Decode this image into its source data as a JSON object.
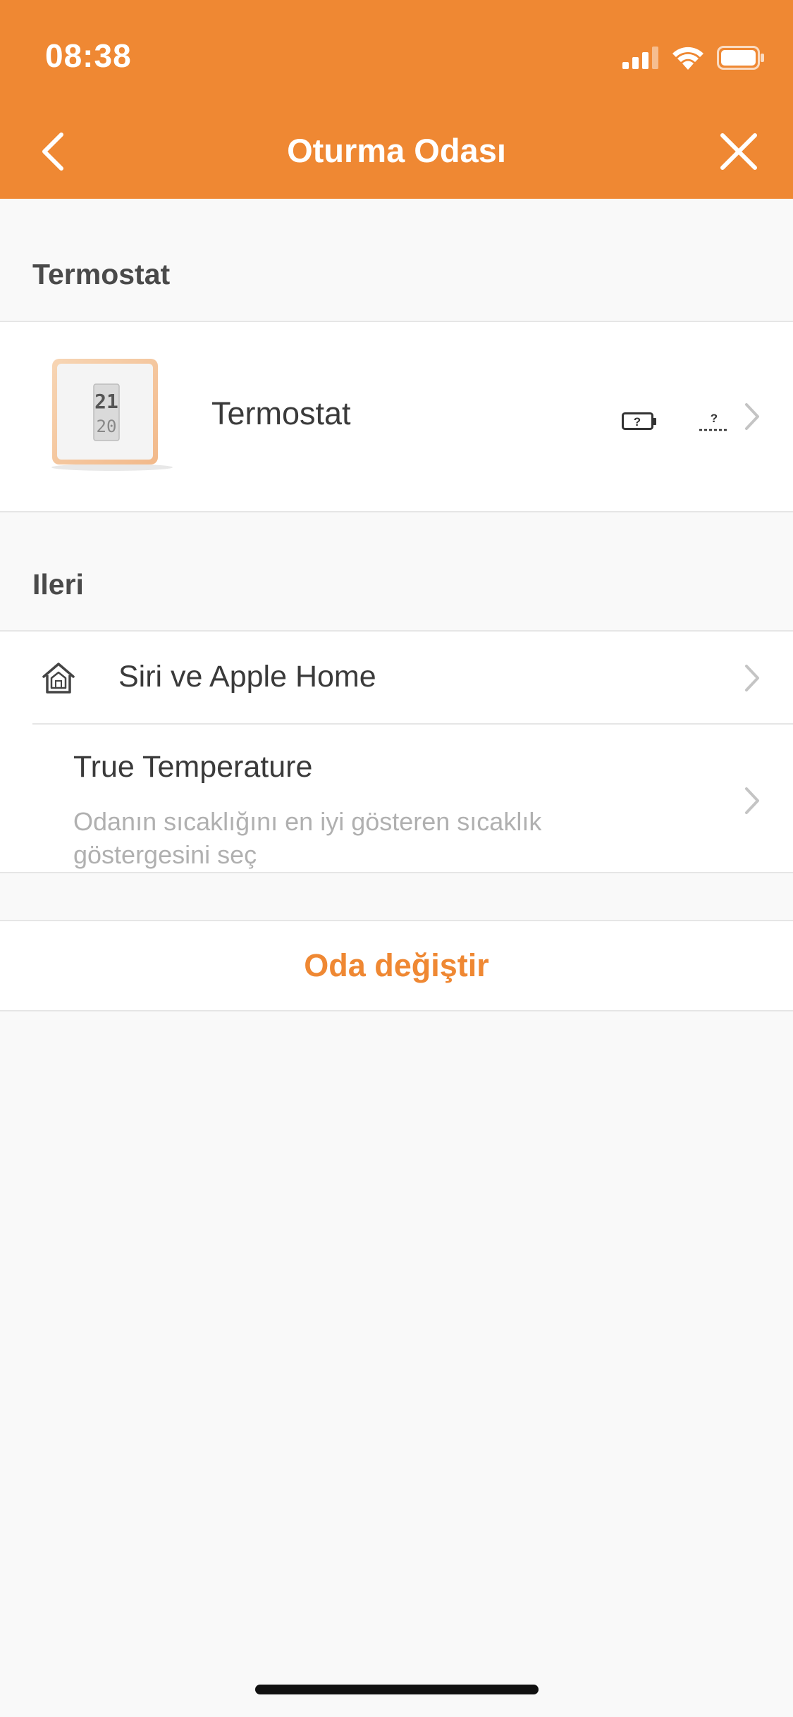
{
  "status_bar": {
    "time": "08:38"
  },
  "nav": {
    "title": "Oturma Odası"
  },
  "sections": {
    "thermostat_header": "Termostat",
    "advanced_header": "Ileri"
  },
  "device": {
    "name": "Termostat",
    "display_top": "21",
    "display_bottom": "20",
    "battery_status": "?",
    "signal_status": "?"
  },
  "advanced_items": [
    {
      "label": "Siri ve Apple Home"
    },
    {
      "label": "True Temperature",
      "description": "Odanın sıcaklığını en iyi gösteren sıcaklık göstergesini seç"
    }
  ],
  "actions": {
    "change_room": "Oda değiştir"
  },
  "colors": {
    "accent": "#ef8833",
    "background": "#f9f9f9",
    "divider": "#e6e6e6"
  }
}
